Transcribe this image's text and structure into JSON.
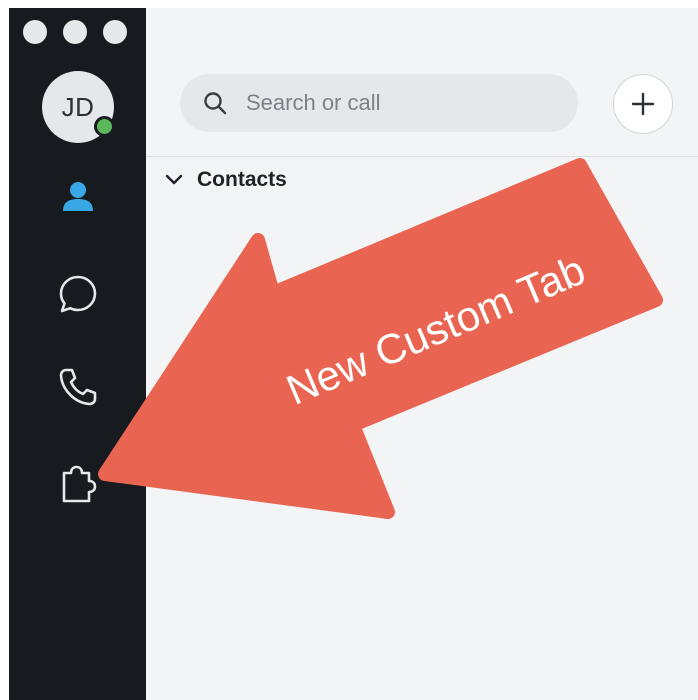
{
  "sidebar": {
    "avatar_initials": "JD",
    "presence_color": "#5cb85c",
    "accent_color": "#38a9e6",
    "nav": [
      {
        "icon": "person-icon",
        "active": true
      },
      {
        "icon": "chat-bubble-icon",
        "active": false
      },
      {
        "icon": "phone-icon",
        "active": false
      },
      {
        "icon": "puzzle-piece-icon",
        "active": false
      }
    ]
  },
  "header": {
    "search_placeholder": "Search or call",
    "add_icon": "plus-icon"
  },
  "contacts": {
    "section_label": "Contacts",
    "expanded": true
  },
  "annotation": {
    "label": "New Custom Tab",
    "color": "#ea6452"
  }
}
